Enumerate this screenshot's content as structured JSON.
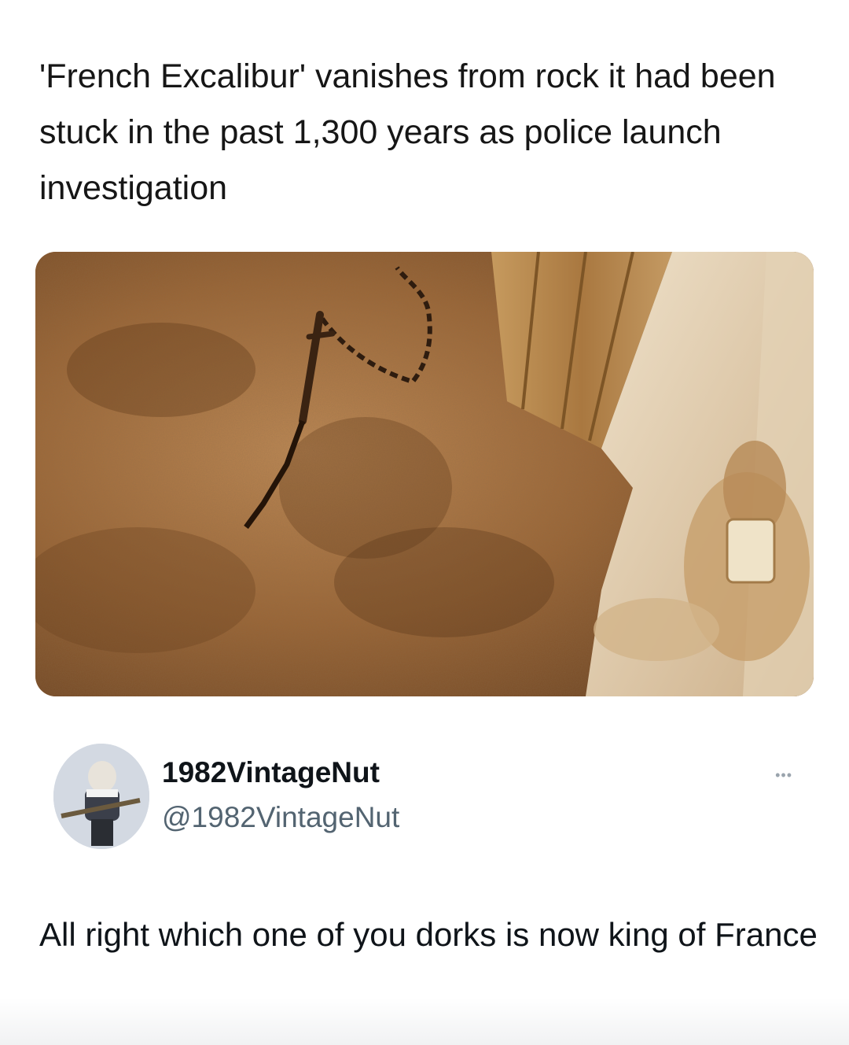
{
  "article": {
    "headline": "'French Excalibur' vanishes from rock it had been stuck in the past 1,300 years as police launch investigation"
  },
  "tweet": {
    "display_name": "1982VintageNut",
    "handle": "@1982VintageNut",
    "more_icon": "more-options-icon",
    "text": "All right which one of you dorks is now king of France"
  }
}
